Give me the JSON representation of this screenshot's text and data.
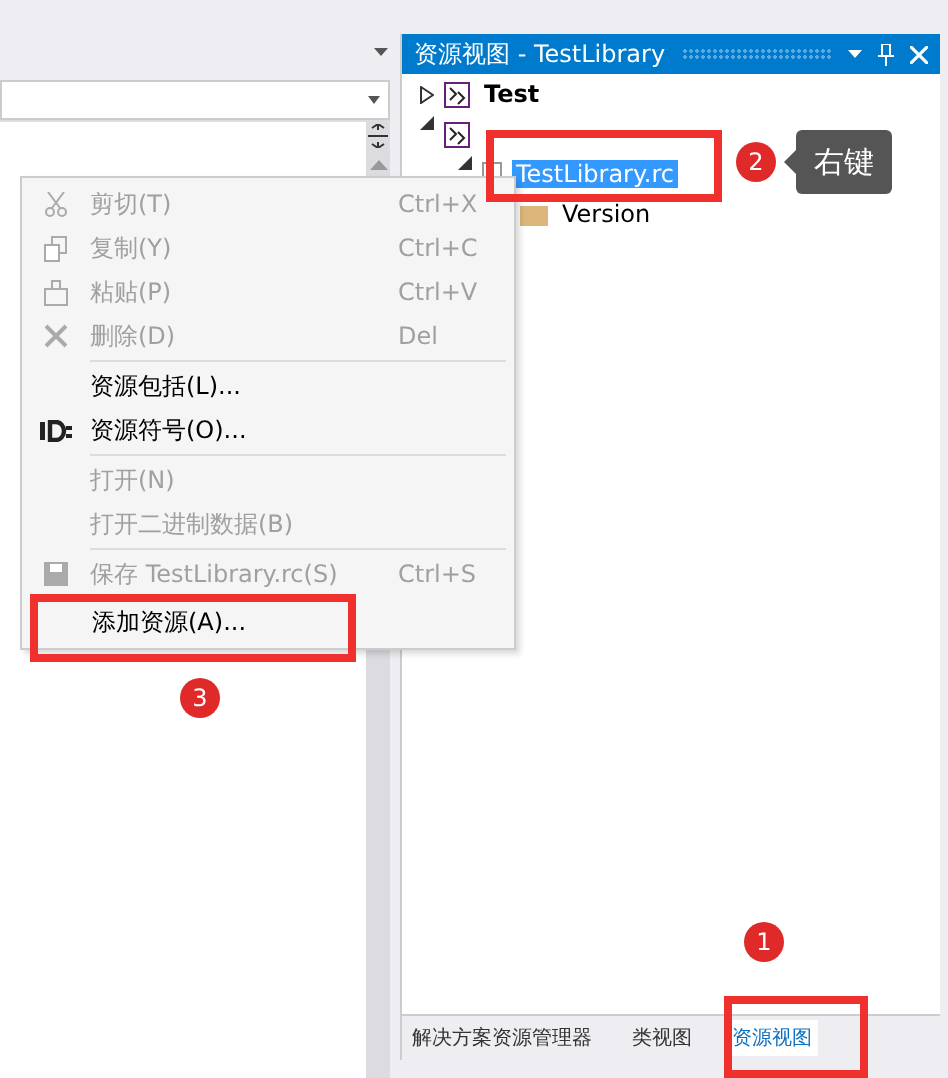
{
  "resource_view": {
    "title": "资源视图 - TestLibrary",
    "tree": [
      {
        "label": "Test",
        "kind": "project",
        "expanded": false,
        "selected": false
      },
      {
        "kind": "project",
        "expanded": true,
        "children": [
          {
            "label": "TestLibrary.rc",
            "kind": "file",
            "expanded": true,
            "selected": true,
            "children": [
              {
                "label": "Version",
                "kind": "folder",
                "selected": false
              }
            ]
          }
        ]
      }
    ],
    "tabs": [
      {
        "label": "解决方案资源管理器",
        "selected": false
      },
      {
        "label": "类视图",
        "selected": false
      },
      {
        "label": "资源视图",
        "selected": true
      }
    ]
  },
  "context_menu": [
    {
      "kind": "item",
      "label": "剪切(T)",
      "shortcut": "Ctrl+X",
      "disabled": true
    },
    {
      "kind": "item",
      "label": "复制(Y)",
      "shortcut": "Ctrl+C",
      "disabled": true
    },
    {
      "kind": "item",
      "label": "粘贴(P)",
      "shortcut": "Ctrl+V",
      "disabled": true
    },
    {
      "kind": "item",
      "label": "删除(D)",
      "shortcut": "Del",
      "disabled": true
    },
    {
      "kind": "separator"
    },
    {
      "kind": "item",
      "label": "资源包括(L)...",
      "disabled": false
    },
    {
      "kind": "item",
      "label": "资源符号(O)...",
      "disabled": false
    },
    {
      "kind": "separator"
    },
    {
      "kind": "item",
      "label": "打开(N)",
      "disabled": true
    },
    {
      "kind": "item",
      "label": "打开二进制数据(B)",
      "disabled": true
    },
    {
      "kind": "separator"
    },
    {
      "kind": "item",
      "label": "保存 TestLibrary.rc(S)",
      "shortcut": "Ctrl+S",
      "disabled": true
    },
    {
      "kind": "item",
      "label": "添加资源(A)...",
      "disabled": false
    }
  ],
  "annotations": [
    {
      "number": "1"
    },
    {
      "number": "2",
      "callout": "右键"
    },
    {
      "number": "3"
    }
  ]
}
